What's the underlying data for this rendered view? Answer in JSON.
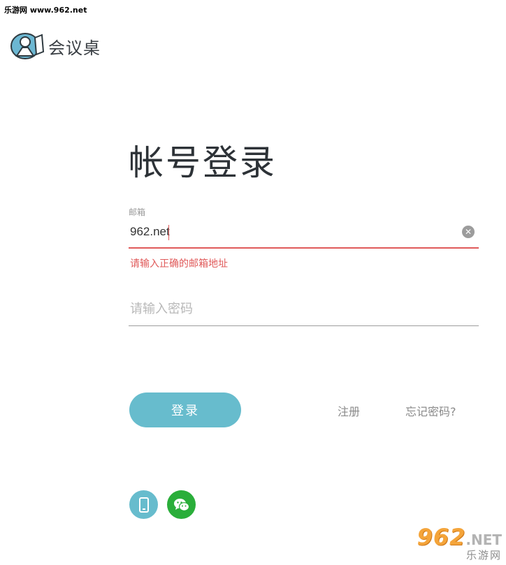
{
  "watermark": {
    "top_text": "乐游网 www.962.net",
    "brand_number": "962",
    "brand_tld": ".NET",
    "brand_name": "乐游网"
  },
  "app": {
    "name": "会议桌"
  },
  "login": {
    "title": "帐号登录",
    "email_label": "邮箱",
    "email_value": "962.net",
    "email_error": "请输入正确的邮箱地址",
    "password_placeholder": "请输入密码",
    "login_button": "登录",
    "register_link": "注册",
    "forgot_link": "忘记密码?"
  },
  "icons": {
    "clear": "clear-icon",
    "phone": "phone-icon",
    "wechat": "wechat-icon",
    "logo": "logo-icon"
  },
  "colors": {
    "accent": "#67bccd",
    "error": "#e05a5a",
    "wechat": "#2aae3a"
  }
}
